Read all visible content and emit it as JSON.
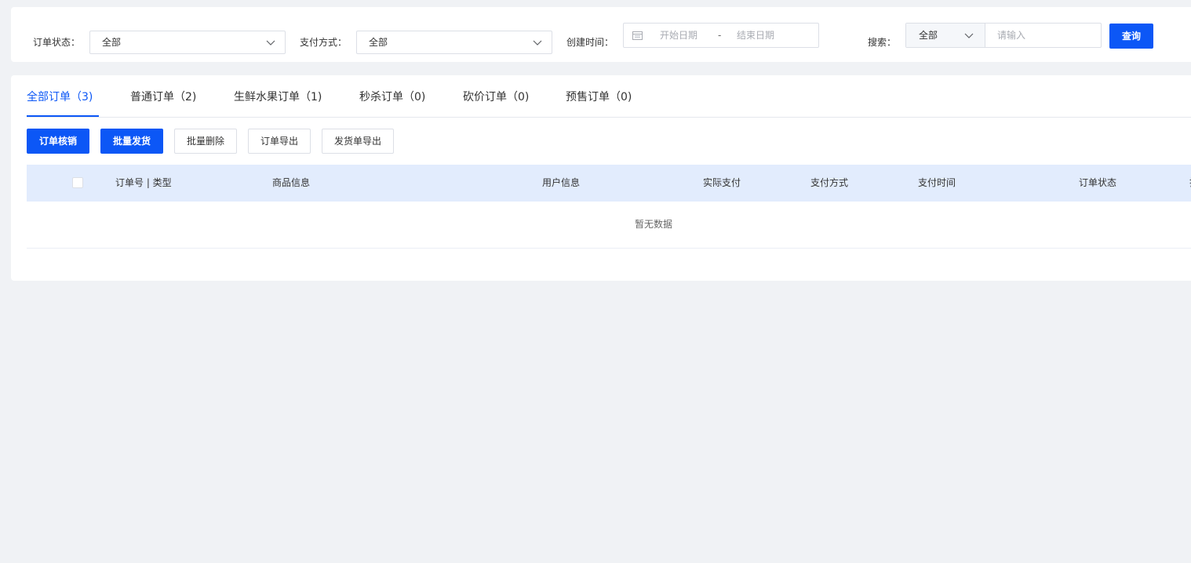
{
  "filters": {
    "order_status": {
      "label": "订单状态：",
      "value": "全部"
    },
    "payment_method": {
      "label": "支付方式：",
      "value": "全部"
    },
    "created_time": {
      "label": "创建时间：",
      "start_placeholder": "开始日期",
      "separator": "-",
      "end_placeholder": "结束日期"
    },
    "search": {
      "label": "搜索：",
      "type_value": "全部",
      "placeholder": "请输入"
    },
    "query_button": "查询"
  },
  "tabs": [
    {
      "label": "全部订单（3)",
      "active": true
    },
    {
      "label": "普通订单（2)",
      "active": false
    },
    {
      "label": "生鲜水果订单（1)",
      "active": false
    },
    {
      "label": "秒杀订单（0)",
      "active": false
    },
    {
      "label": "砍价订单（0)",
      "active": false
    },
    {
      "label": "预售订单（0)",
      "active": false
    }
  ],
  "actions": {
    "verify": "订单核销",
    "batch_ship": "批量发货",
    "batch_delete": "批量删除",
    "export_orders": "订单导出",
    "export_shipping": "发货单导出"
  },
  "table": {
    "columns": [
      "订单号 | 类型",
      "商品信息",
      "用户信息",
      "实际支付",
      "支付方式",
      "支付时间",
      "订单状态",
      "操"
    ],
    "empty_text": "暂无数据"
  },
  "colors": {
    "primary": "#0c57f6",
    "table_header_bg": "#e2ecfd",
    "page_bg": "#f0f2f5"
  },
  "icons": {
    "dropdown": "chevron-down-icon",
    "date": "calendar-icon"
  }
}
